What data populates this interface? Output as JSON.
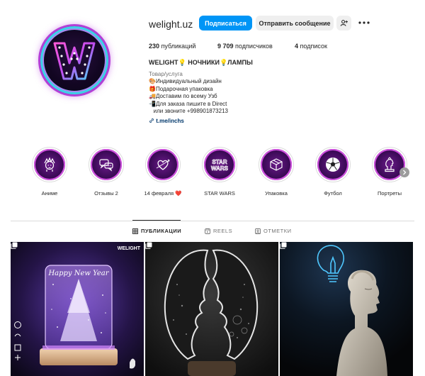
{
  "profile": {
    "username": "welight.uz",
    "follow_label": "Подписаться",
    "message_label": "Отправить сообщение",
    "suggest_icon": "add-person-icon",
    "more_icon": "more-horizontal-icon",
    "avatar_letter": "W"
  },
  "stats": {
    "posts_count": "230",
    "posts_label": "публикаций",
    "followers_count": "9 709",
    "followers_label": "подписчиков",
    "following_count": "4",
    "following_label": "подписок"
  },
  "bio": {
    "name": "WELIGHT💡 НОЧНИКИ💡ЛАМПЫ",
    "category": "Товар/услуга",
    "lines": [
      "🎨Индивидуальный дизайн",
      "🎁Подарочная упаковка",
      "🚚Доставим по всему Узб",
      "📲Для заказа пишите в Direct",
      "   или звоните +998901873213"
    ],
    "link": "t.me/inchs",
    "link_icon": "link-icon"
  },
  "highlights": [
    {
      "label": "Аниме",
      "icon": "anime-face-icon"
    },
    {
      "label": "Отзывы 2",
      "icon": "chat-bubbles-icon"
    },
    {
      "label": "14 февраля ❤️",
      "icon": "heart-arrow-icon"
    },
    {
      "label": "STAR WARS",
      "icon": "star-wars-logo-icon",
      "icon_text": "STAR WARS"
    },
    {
      "label": "Упаковка",
      "icon": "package-box-icon"
    },
    {
      "label": "Футбол",
      "icon": "football-icon"
    },
    {
      "label": "Портреты",
      "icon": "portrait-bust-icon"
    }
  ],
  "tabs": [
    {
      "label": "ПУБЛИКАЦИИ",
      "icon": "grid-icon",
      "active": true
    },
    {
      "label": "REELS",
      "icon": "reels-icon",
      "active": false
    },
    {
      "label": "ОТМЕТКИ",
      "icon": "tagged-icon",
      "active": false
    }
  ],
  "posts": [
    {
      "description": "Happy New Year lamp",
      "caption_text": "Happy New Year",
      "brand_text": "WELIGHT",
      "icon": "multi-photo-icon"
    },
    {
      "description": "Two faces lamp",
      "icon": "multi-photo-icon"
    },
    {
      "description": "Bulb and bust",
      "icon": "multi-photo-icon"
    }
  ],
  "colors": {
    "follow_button": "#0095f6",
    "neon_purple": "#b23fd6",
    "neon_cyan": "#3fd0e8"
  }
}
